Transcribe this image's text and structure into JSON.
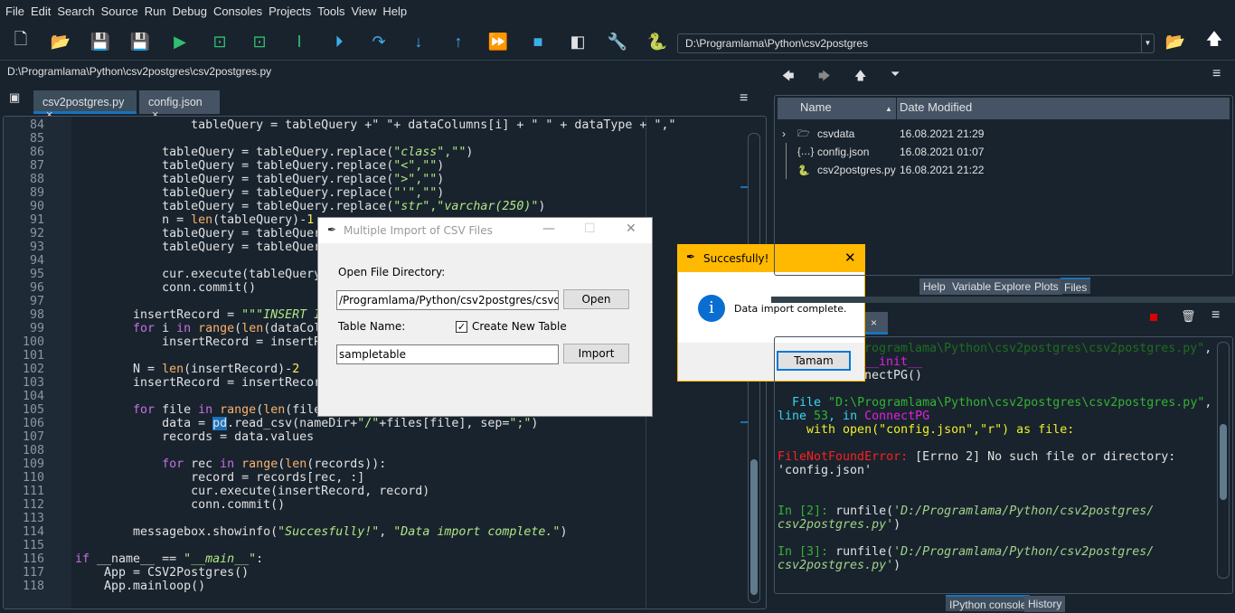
{
  "menu": [
    "File",
    "Edit",
    "Search",
    "Source",
    "Run",
    "Debug",
    "Consoles",
    "Projects",
    "Tools",
    "View",
    "Help"
  ],
  "toolbar": {
    "icons": [
      "new-file-icon",
      "open-file-icon",
      "save-icon",
      "save-all-icon",
      "run-icon",
      "run-cell-icon",
      "run-cell-advance-icon",
      "run-selection-icon",
      "debug-icon",
      "step-over-icon",
      "step-into-icon",
      "step-return-icon",
      "continue-icon",
      "stop-icon",
      "maximize-pane-icon",
      "preferences-wrench-icon",
      "python-path-icon"
    ],
    "working_dir": "D:\\Programlama\\Python\\csv2postgres"
  },
  "editor": {
    "file_path": "D:\\Programlama\\Python\\csv2postgres\\csv2postgres.py",
    "tabs": [
      {
        "label": "csv2postgres.py",
        "active": true
      },
      {
        "label": "config.json",
        "active": false
      }
    ],
    "lines": [
      {
        "no": "84",
        "tokens": [
          [
            "                tableQuery = tableQuery +\" \"+ dataColumns[i] + \" \" + dataType + \",\"",
            ""
          ]
        ]
      },
      {
        "no": "85",
        "tokens": []
      },
      {
        "no": "86",
        "tokens": [
          [
            "            tableQuery = tableQuery.replace(",
            ""
          ],
          [
            "\"",
            "st"
          ],
          [
            "class",
            "it"
          ],
          [
            "\",\"\"",
            "st"
          ],
          [
            ")",
            ""
          ]
        ]
      },
      {
        "no": "87",
        "tokens": [
          [
            "            tableQuery = tableQuery.replace(",
            ""
          ],
          [
            "\"<\",\"\"",
            "st"
          ],
          [
            ")",
            ""
          ]
        ]
      },
      {
        "no": "88",
        "tokens": [
          [
            "            tableQuery = tableQuery.replace(",
            ""
          ],
          [
            "\">\",\"\"",
            "st"
          ],
          [
            ")",
            ""
          ]
        ]
      },
      {
        "no": "89",
        "tokens": [
          [
            "            tableQuery = tableQuery.replace(",
            ""
          ],
          [
            "\"'\",\"\"",
            "st"
          ],
          [
            ")",
            ""
          ]
        ]
      },
      {
        "no": "90",
        "tokens": [
          [
            "            tableQuery = tableQuery.replace(",
            ""
          ],
          [
            "\"",
            "st"
          ],
          [
            "str",
            "it"
          ],
          [
            "\",\"",
            "st"
          ],
          [
            "varchar(250)",
            "it"
          ],
          [
            "\"",
            "st"
          ],
          [
            ")",
            ""
          ]
        ]
      },
      {
        "no": "91",
        "tokens": [
          [
            "            n = ",
            ""
          ],
          [
            "len",
            "bi"
          ],
          [
            "(tableQuery)-",
            ""
          ],
          [
            "1",
            "nm"
          ]
        ]
      },
      {
        "no": "92",
        "tokens": [
          [
            "            tableQuery = tableQuer",
            ""
          ]
        ]
      },
      {
        "no": "93",
        "tokens": [
          [
            "            tableQuery = tableQuer",
            ""
          ]
        ]
      },
      {
        "no": "94",
        "tokens": []
      },
      {
        "no": "95",
        "tokens": [
          [
            "            cur.execute(tableQuery",
            ""
          ]
        ]
      },
      {
        "no": "96",
        "tokens": [
          [
            "            conn.commit()",
            ""
          ]
        ]
      },
      {
        "no": "97",
        "tokens": []
      },
      {
        "no": "98",
        "tokens": [
          [
            "        insertRecord = ",
            ""
          ],
          [
            "\"\"\"",
            "st"
          ],
          [
            "INSERT I",
            "it"
          ]
        ]
      },
      {
        "no": "99",
        "tokens": [
          [
            "        ",
            ""
          ],
          [
            "for",
            "kw"
          ],
          [
            " i ",
            ""
          ],
          [
            "in",
            "kw"
          ],
          [
            " ",
            ""
          ],
          [
            "range",
            "bi"
          ],
          [
            "(",
            ""
          ],
          [
            "len",
            "bi"
          ],
          [
            "(dataCol",
            ""
          ]
        ]
      },
      {
        "no": "100",
        "tokens": [
          [
            "            insertRecord = insertR",
            ""
          ]
        ]
      },
      {
        "no": "101",
        "tokens": []
      },
      {
        "no": "102",
        "tokens": [
          [
            "        N = ",
            ""
          ],
          [
            "len",
            "bi"
          ],
          [
            "(insertRecord)-",
            ""
          ],
          [
            "2",
            "nm"
          ]
        ]
      },
      {
        "no": "103",
        "tokens": [
          [
            "        insertRecord = insertRecor",
            ""
          ]
        ]
      },
      {
        "no": "104",
        "tokens": []
      },
      {
        "no": "105",
        "tokens": [
          [
            "        ",
            ""
          ],
          [
            "for",
            "kw"
          ],
          [
            " file ",
            ""
          ],
          [
            "in",
            "kw"
          ],
          [
            " ",
            ""
          ],
          [
            "range",
            "bi"
          ],
          [
            "(",
            ""
          ],
          [
            "len",
            "bi"
          ],
          [
            "(file",
            ""
          ]
        ]
      },
      {
        "no": "106",
        "tokens": [
          [
            "            data = ",
            ""
          ],
          [
            "pd",
            "sel"
          ],
          [
            ".read_csv(nameDir+",
            ""
          ],
          [
            "\"/\"",
            "st"
          ],
          [
            "+files[file], sep=",
            ""
          ],
          [
            "\";\"",
            "st"
          ],
          [
            ")",
            ""
          ]
        ]
      },
      {
        "no": "107",
        "tokens": [
          [
            "            records = data.values",
            ""
          ]
        ]
      },
      {
        "no": "108",
        "tokens": []
      },
      {
        "no": "109",
        "tokens": [
          [
            "            ",
            ""
          ],
          [
            "for",
            "kw"
          ],
          [
            " rec ",
            ""
          ],
          [
            "in",
            "kw"
          ],
          [
            " ",
            ""
          ],
          [
            "range",
            "bi"
          ],
          [
            "(",
            ""
          ],
          [
            "len",
            "bi"
          ],
          [
            "(records)):",
            ""
          ]
        ]
      },
      {
        "no": "110",
        "tokens": [
          [
            "                record = records[rec, :]",
            ""
          ]
        ]
      },
      {
        "no": "111",
        "tokens": [
          [
            "                cur.execute(insertRecord, record)",
            ""
          ]
        ]
      },
      {
        "no": "112",
        "tokens": [
          [
            "                conn.commit()",
            ""
          ]
        ]
      },
      {
        "no": "113",
        "tokens": []
      },
      {
        "no": "114",
        "tokens": [
          [
            "        messagebox.showinfo(",
            ""
          ],
          [
            "\"",
            "st"
          ],
          [
            "Succesfully!",
            "it"
          ],
          [
            "\"",
            "st"
          ],
          [
            ", ",
            ""
          ],
          [
            "\"",
            "st"
          ],
          [
            "Data import complete.",
            "it"
          ],
          [
            "\"",
            "st"
          ],
          [
            ")",
            ""
          ]
        ]
      },
      {
        "no": "115",
        "tokens": []
      },
      {
        "no": "116",
        "tokens": [
          [
            "if",
            "kw"
          ],
          [
            " __name__ == ",
            ""
          ],
          [
            "\"",
            "st"
          ],
          [
            "__main__",
            "it"
          ],
          [
            "\"",
            "st"
          ],
          [
            ":",
            ""
          ]
        ]
      },
      {
        "no": "117",
        "tokens": [
          [
            "    App = CSV2Postgres()",
            ""
          ]
        ]
      },
      {
        "no": "118",
        "tokens": [
          [
            "    App.mainloop()",
            ""
          ]
        ]
      }
    ]
  },
  "import_dialog": {
    "title": "Multiple Import of CSV Files",
    "dir_label": "Open File Directory:",
    "dir_value": "/Programlama/Python/csv2postgres/csvdata",
    "open_button": "Open",
    "table_label": "Table Name:",
    "create_new_table": "Create New Table",
    "create_new_table_checked": true,
    "table_value": "sampletable",
    "import_button": "Import"
  },
  "message_dialog": {
    "title": "Succesfully!",
    "message": "Data import complete.",
    "ok_button": "Tamam",
    "accent": "#ffb900"
  },
  "files": {
    "columns": [
      "Name",
      "Date Modified"
    ],
    "rows": [
      {
        "name": "csvdata",
        "date": "16.08.2021 21:29",
        "icon": "folder-icon"
      },
      {
        "name": "config.json",
        "date": "16.08.2021 01:07",
        "icon": "json-file-icon"
      },
      {
        "name": "csv2postgres.py",
        "date": "16.08.2021 21:22",
        "icon": "python-file-icon"
      }
    ],
    "tabs": [
      "Help",
      "Variable Explorer",
      "Plots",
      "Files"
    ],
    "active_tab": "Files"
  },
  "console": {
    "lines": [
      [
        [
          "rogramlama\\Python\\csv2postgres\\csv2postgres.py\"",
          "c-dim"
        ],
        [
          ",",
          "c-wh"
        ]
      ],
      [
        [
          "__init__",
          "c-mag"
        ]
      ],
      [
        [
          "nectPG()",
          "c-wh"
        ]
      ],
      [],
      [
        [
          "  File ",
          "c-cyan"
        ],
        [
          "\"D:\\Programlama\\Python\\csv2postgres\\csv2postgres.py\"",
          "c-green"
        ],
        [
          ",",
          "c-wh"
        ]
      ],
      [
        [
          "line ",
          "c-cyan"
        ],
        [
          "53",
          "c-green"
        ],
        [
          ", in ",
          "c-cyan"
        ],
        [
          "ConnectPG",
          "c-mag"
        ]
      ],
      [
        [
          "    with open(\"config.json\",\"r\") as file:",
          "c-yel"
        ]
      ],
      [],
      [
        [
          "FileNotFoundError",
          "c-red"
        ],
        [
          ": ",
          "c-red"
        ],
        [
          "[Errno 2] No such file or directory:",
          "c-wh"
        ]
      ],
      [
        [
          "'config.json'",
          "c-wh"
        ]
      ],
      [],
      [],
      [
        [
          "In [",
          "c-green"
        ],
        [
          "2",
          "c-green"
        ],
        [
          "]: ",
          "c-green"
        ],
        [
          "runfile(",
          "c-wh"
        ],
        [
          "'D:/Programlama/Python/csv2postgres/",
          "c-it"
        ]
      ],
      [
        [
          "csv2postgres.py'",
          "c-it"
        ],
        [
          ")",
          "c-wh"
        ]
      ],
      [],
      [
        [
          "In [",
          "c-green"
        ],
        [
          "3",
          "c-green"
        ],
        [
          "]: ",
          "c-green"
        ],
        [
          "runfile(",
          "c-wh"
        ],
        [
          "'D:/Programlama/Python/csv2postgres/",
          "c-it"
        ]
      ],
      [
        [
          "csv2postgres.py'",
          "c-it"
        ],
        [
          ")",
          "c-wh"
        ]
      ]
    ],
    "tabs": [
      "IPython console",
      "History"
    ],
    "active_tab": "IPython console"
  }
}
